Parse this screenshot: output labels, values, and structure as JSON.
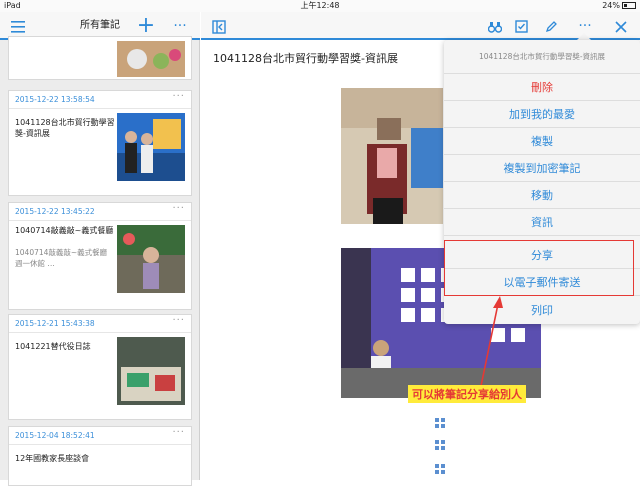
{
  "statusbar": {
    "device": "iPad",
    "time": "上午12:48",
    "battery": "24%"
  },
  "left": {
    "title": "所有筆記",
    "notes": [
      {
        "date": "",
        "title": "",
        "body": ""
      },
      {
        "date": "2015-12-22 13:58:54",
        "title": "1041128台北市貿行動學習獎-資訊展",
        "body": ""
      },
      {
        "date": "2015-12-22 13:45:22",
        "title": "1040714敲義敲~義式餐廳",
        "body": "1040714敲義敲~義式餐廳 週一休館 …"
      },
      {
        "date": "2015-12-21 15:43:38",
        "title": "1041221替代役日誌",
        "body": ""
      },
      {
        "date": "2015-12-04 18:52:41",
        "title": "12年國教家長座談會",
        "body": ""
      }
    ],
    "more": "···"
  },
  "right": {
    "doc_title": "1041128台北市貿行動學習獎-資訊展"
  },
  "popup": {
    "header": "1041128台北市貿行動學習獎-資訊展",
    "items": [
      "刪除",
      "加到我的最愛",
      "複製",
      "複製到加密筆記",
      "移動",
      "資訊",
      "分享",
      "以電子郵件寄送",
      "列印"
    ]
  },
  "annotation": {
    "callout": "可以將筆記分享給別人"
  },
  "colors": {
    "accent": "#2f8ad8",
    "danger": "#e53935",
    "callout_bg": "#ffeb3b"
  }
}
